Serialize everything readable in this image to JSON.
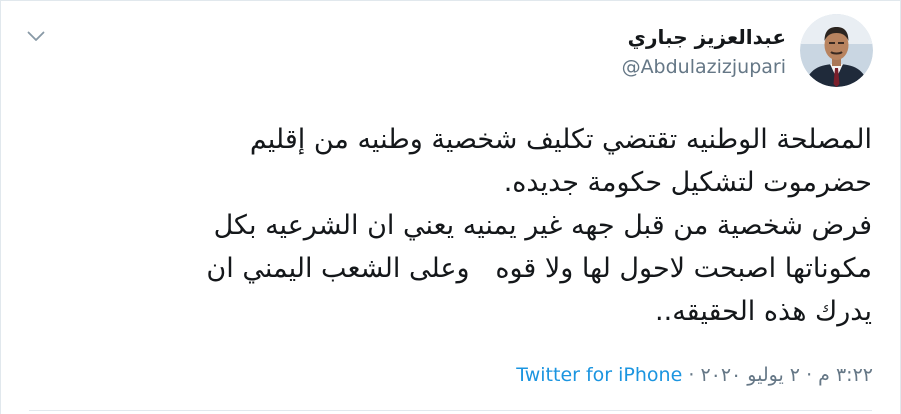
{
  "tweet": {
    "author": {
      "display_name": "عبدالعزيز جباري",
      "handle": "@Abdulazizjupari"
    },
    "lines": [
      "المصلحة الوطنيه تقتضي تكليف شخصية وطنيه من إقليم",
      "حضرموت لتشكيل حكومة جديده.",
      "فرض شخصية من قبل جهه غير يمنيه يعني ان الشرعيه بكل",
      "مكوناتها اصبحت لاحول لها ولا قوه   وعلى الشعب اليمني ان",
      "يدرك هذه الحقيقه.."
    ],
    "time": "٣:٢٢ م",
    "date": "٢ يوليو ٢٠٢٠",
    "separator": "·",
    "source": "Twitter for iPhone"
  },
  "icons": {
    "menu": "chevron-down-icon",
    "avatar": "avatar"
  },
  "colors": {
    "text": "#14171a",
    "secondary": "#657786",
    "link": "#1b95e0",
    "border": "#e1e8ed"
  }
}
